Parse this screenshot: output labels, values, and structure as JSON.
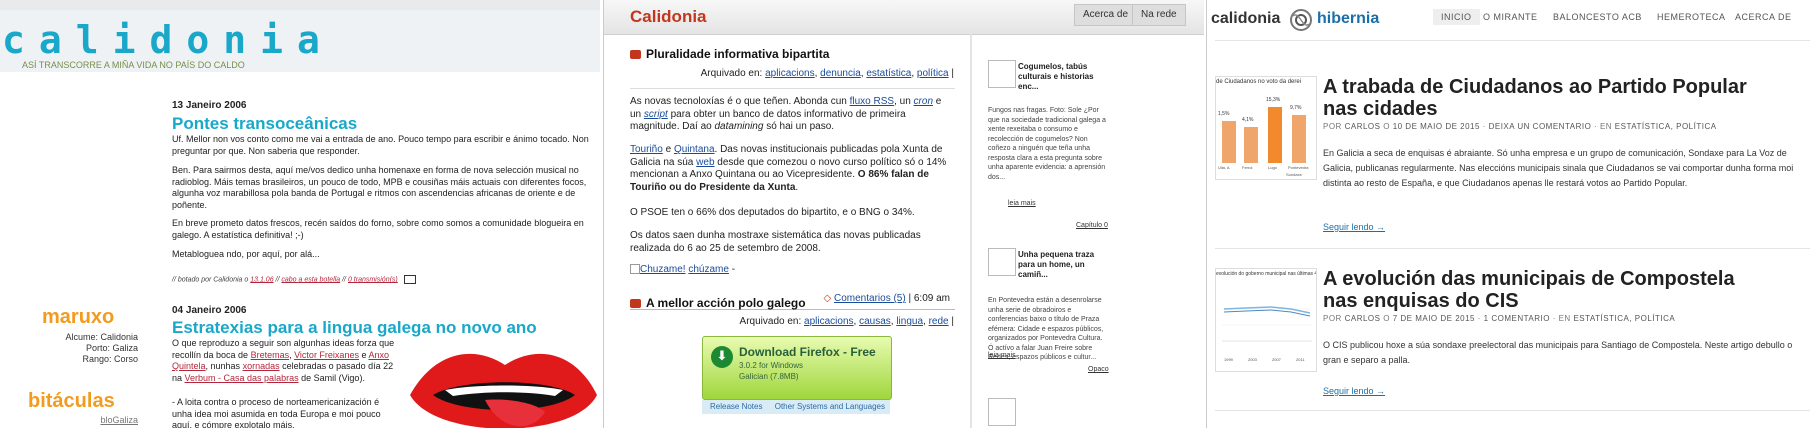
{
  "colors": {
    "calidonia_blue": "#19a8c9",
    "orange": "#f39b1e",
    "red": "#c3361e",
    "hibernia_blue": "#1b6fa8"
  },
  "p1": {
    "logo": "calidonia",
    "tagline": "ASÍ TRANSCORRE A MIÑA VIDA NO PAÍS DO CALDO",
    "post1": {
      "date": "13 Janeiro 2006",
      "title": "Pontes transoceânicas",
      "para1": "Uf. Mellor non vos conto como me vai a entrada de ano. Pouco tempo para escribir e ánimo tocado. Non preguntar por que. Non saberia que responder.",
      "para2": "Ben. Para sairmos desta, aquí me/vos dedico unha homenaxe en forma de nova selección musical no radioblog. Máis temas brasileiros, un pouco de todo, MPB e cousiñas máis actuais con diferentes focos, algunha voz marabillosa pola banda de Portugal e ritmos con ascendencias africanas de oriente e de poñente.",
      "para3": "En breve prometo datos frescos, recén saídos do forno, sobre como somos a comunidade blogueira en galego. A estatística definitiva! ;-)",
      "para4": "Metabloguea ndo, por aquí, por alá...",
      "meta_prefix": "// botado por Calidonia o",
      "meta_time": "13.1.06",
      "meta_sep1": "//",
      "meta_cat": "cabo a esta botella",
      "meta_sep2": "//",
      "meta_comments": "0 transmisión(s)"
    },
    "post2": {
      "date": "04 Janeiro 2006",
      "title": "Estratexias para a lingua galega no novo ano",
      "text_a": "O que reproduzo a seguir son algunhas ideas forza que recollín da boca de ",
      "link1": "Bretemas",
      "sep1": ", ",
      "link2": "Victor Freixanes",
      "text_b": " e ",
      "link3": "Anxo Quintela",
      "text_c": ", nunhas ",
      "link4": "xornadas",
      "text_d": " celebradas o pasado día 22 na ",
      "link5": "Verbum - Casa das palabras",
      "text_e": " de Samil (Vigo).",
      "text_f": "- A loita contra o proceso de norteamericanización é unha idea moi asumida en toda Europa e moi pouco aquí, e cómpre explotalo máis."
    },
    "sidebar": {
      "title1": "maruxo",
      "alcume": "Alcume: Calidonia",
      "porto": "Porto: Galiza",
      "rango": "Rango: Corso",
      "title2": "bitáculas",
      "blog_link": "bloGaliza"
    }
  },
  "p2": {
    "brand": "Calidonia",
    "nav": [
      "Acerca de",
      "Na rede"
    ],
    "post1": {
      "title": "Pluralidade informativa bipartita",
      "filed_label": "Arquivado en:",
      "tags": [
        "aplicacions",
        "denuncia",
        "estatística",
        "política"
      ],
      "p1a": "As novas tecnoloxías é o que teñen. Abonda cun ",
      "p1l1": "fluxo RSS",
      "p1b": ", un ",
      "p1l2": "cron",
      "p1c": " e un ",
      "p1l3": "script",
      "p1d": " para obter un banco de datos informativo de primeira magnitude. Daí ao ",
      "p1e": "datamining",
      "p1f": " só hai un paso.",
      "p2l1": "Touriño",
      "p2a": " e ",
      "p2l2": "Quintana",
      "p2b": ". Das novas institucionais publicadas pola Xunta de Galicia na súa ",
      "p2l3": "web",
      "p2c": " desde que comezou o novo curso político só o 14% mencionan a Anxo Quintana ou ao Vicepresidente. ",
      "p2bold": "O 86% falan de Touriño ou do Presidente da Xunta",
      "p2end": ".",
      "p3": "O PSOE ten o 66% dos deputados do bipartito, e o BNG o 34%.",
      "p4": "Os datos saen dunha mostraxe sistemática das novas publicadas realizada do 6 ao 25 de setembro de 2008.",
      "chuzame": "Chuzame!",
      "chuzame_link": "chúzame",
      "chuzame_dash": "-",
      "comments": "Comentarios (5)",
      "time": "6:09 am"
    },
    "post2": {
      "title": "A mellor acción polo galego",
      "filed_label": "Arquivado en:",
      "tags": [
        "aplicacions",
        "causas",
        "lingua",
        "rede"
      ]
    },
    "firefox": {
      "line1": "Download Firefox - Free",
      "line2": "3.0.2 for Windows",
      "line3": "Galician (7.8MB)",
      "notes": "Release Notes",
      "other": "Other Systems and Languages"
    },
    "sidebar": [
      {
        "title": "Cogumelos, tabús culturais e historias enc...",
        "text": "Fungos nas fragas. Foto: Sole ¿Por que na sociedade tradicional galega a xente rexeitaba o consumo e recolección de cogumelos? Non coñezo a ninguén que teña unha resposta clara a esta pregunta sobre unha aparente evidencia: a aprensión dos...",
        "more": "leia mais",
        "source": "Capítulo 0"
      },
      {
        "title": "Unha pequena traza para un home, un camiñ...",
        "text": "En Pontevedra están a desenrolarse unha serie de obradoiros e conferencias baixo o título de Praza efémera: Cidade e espazos públicos, organizados por Pontevedra Cultura. Ó actívo a falar Juan Freire sobre Redes, espazos públicos e cultur...",
        "more": "leia mais",
        "source": "Opaco"
      }
    ]
  },
  "p3": {
    "brand1": "calidonia",
    "brand2": "hibernia",
    "menu": [
      "INICIO",
      "O MIRANTE",
      "BALONCESTO ACB",
      "HEMEROTECA",
      "ACERCA DE"
    ],
    "post1": {
      "title": "A trabada de Ciudadanos ao Partido Popular nas cidades",
      "meta_by": "POR",
      "meta_author": "CARLOS",
      "meta_o": "O",
      "meta_date": "10 DE MAIO DE 2015",
      "meta_dash1": "·",
      "meta_comment": "DEIXA UN COMENTARIO",
      "meta_dash2": "·",
      "meta_in": "EN",
      "meta_cats": "ESTATÍSTICA, POLÍTICA",
      "text": "En Galicia a seca de enquisas é abraiante. Só unha empresa e un grupo de comunicación, Sondaxe para La Voz de Galicia, publicanas regularmente. Nas eleccións municipais sinala que Ciudadanos se vai comportar dunha forma moi distinta ao resto de España, e que Ciudadanos apenas lle restará votos ao Partido Popular.",
      "more": "Seguir lendo →",
      "thumb_title": "de Ciudadanos no voto da derei",
      "thumb_labels": [
        "Ulla, A",
        "Ferrol",
        "Lugo",
        "Pontevedra"
      ],
      "thumb_values": [
        "1,5%",
        "4,1%",
        "15,3%",
        "9,7%"
      ],
      "thumb_footer": "Sondaxe"
    },
    "post2": {
      "title": "A evolución das municipais de Compostela nas enquisas do CIS",
      "meta_by": "POR",
      "meta_author": "CARLOS",
      "meta_o": "O",
      "meta_date": "7 DE MAIO DE 2015",
      "meta_dash1": "·",
      "meta_comment": "1 COMENTARIO",
      "meta_dash2": "·",
      "meta_in": "EN",
      "meta_cats": "ESTATÍSTICA, POLÍTICA",
      "text": "O CIS publicou hoxe a súa sondaxe preelectoral das municipais para Santiago de Compostela. Neste artigo debullo o gran e separo a palla.",
      "more": "Seguir lendo →",
      "thumb_title": "evolución do goberno municipal nas últimas 4 pos",
      "thumb_years": [
        "1999",
        "2003",
        "2007",
        "2011"
      ]
    }
  }
}
